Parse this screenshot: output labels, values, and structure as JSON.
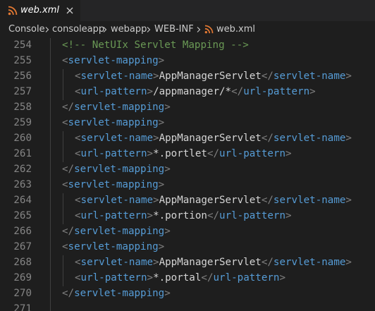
{
  "tab": {
    "filename": "web.xml",
    "icon": "rss-icon",
    "close_icon": "close-icon"
  },
  "breadcrumb": {
    "segments": [
      "Console",
      "consoleapp",
      "webapp",
      "WEB-INF",
      "web.xml"
    ]
  },
  "editor": {
    "lines": [
      {
        "number": "254",
        "comment": "<!-- NetUIx Servlet Mapping -->"
      },
      {
        "number": "255",
        "tag": "servlet-mapping"
      },
      {
        "number": "256",
        "tag": "servlet-name",
        "text": "AppManagerServlet"
      },
      {
        "number": "257",
        "tag": "url-pattern",
        "text": "/appmanager/*"
      },
      {
        "number": "258",
        "tag": "servlet-mapping"
      },
      {
        "number": "259",
        "tag": "servlet-mapping"
      },
      {
        "number": "260",
        "tag": "servlet-name",
        "text": "AppManagerServlet"
      },
      {
        "number": "261",
        "tag": "url-pattern",
        "text": "*.portlet"
      },
      {
        "number": "262",
        "tag": "servlet-mapping"
      },
      {
        "number": "263",
        "tag": "servlet-mapping"
      },
      {
        "number": "264",
        "tag": "servlet-name",
        "text": "AppManagerServlet"
      },
      {
        "number": "265",
        "tag": "url-pattern",
        "text": "*.portion"
      },
      {
        "number": "266",
        "tag": "servlet-mapping"
      },
      {
        "number": "267",
        "tag": "servlet-mapping"
      },
      {
        "number": "268",
        "tag": "servlet-name",
        "text": "AppManagerServlet"
      },
      {
        "number": "269",
        "tag": "url-pattern",
        "text": "*.portal"
      },
      {
        "number": "270",
        "tag": "servlet-mapping"
      },
      {
        "number": "271"
      }
    ]
  },
  "colors": {
    "background": "#1e1e1e",
    "tag": "#569cd6",
    "punctuation": "#808080",
    "text": "#d4d4d4",
    "comment": "#6a9955",
    "line_number": "#858585",
    "xml_icon": "#e37933"
  }
}
